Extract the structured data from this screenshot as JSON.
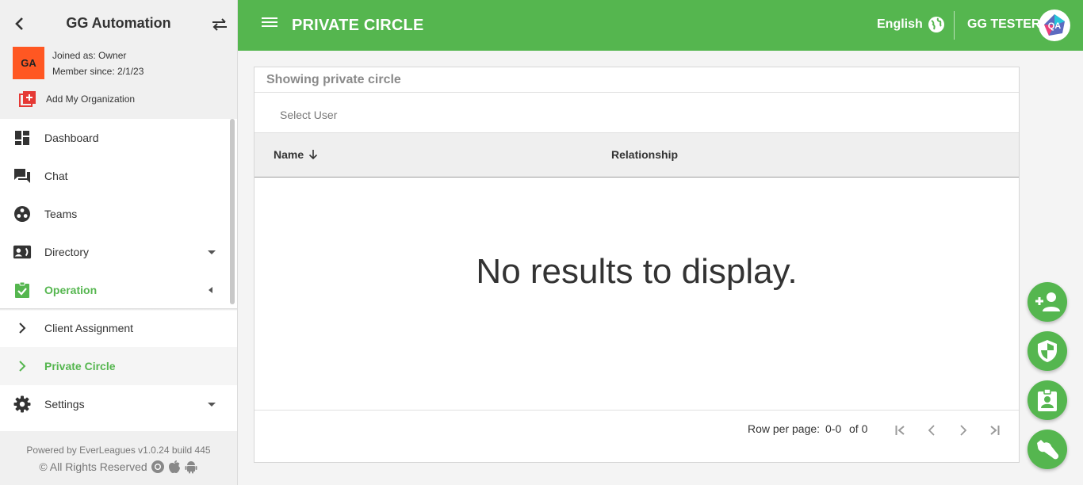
{
  "sidebar": {
    "org_name": "GG Automation",
    "org_avatar_text": "GA",
    "joined_as": "Joined as: Owner",
    "member_since": "Member since: 2/1/23",
    "add_org_label": "Add My Organization",
    "items": [
      {
        "label": "Dashboard",
        "icon": "dashboard-icon"
      },
      {
        "label": "Chat",
        "icon": "chat-icon"
      },
      {
        "label": "Teams",
        "icon": "teams-icon"
      },
      {
        "label": "Directory",
        "icon": "contact-card-icon"
      },
      {
        "label": "Operation",
        "icon": "clipboard-check-icon"
      },
      {
        "label": "Client Assignment",
        "icon": "chevron-right-icon"
      },
      {
        "label": "Private Circle",
        "icon": "chevron-right-icon"
      },
      {
        "label": "Settings",
        "icon": "gear-icon"
      }
    ],
    "footer_powered": "Powered by EverLeagues v1.0.24 build 445",
    "footer_rights": "© All Rights Reserved"
  },
  "topbar": {
    "title": "PRIVATE CIRCLE",
    "language": "English",
    "user_name": "GG TESTER",
    "user_avatar_text": "QA"
  },
  "main": {
    "card_title": "Showing private circle",
    "select_user": "Select User",
    "columns": {
      "name": "Name",
      "relationship": "Relationship"
    },
    "empty_text": "No results to display.",
    "pager": {
      "label": "Row per page:",
      "range": "0-0",
      "of": "of 0"
    }
  },
  "colors": {
    "brand": "#55b64f",
    "avatar": "#ff5722"
  }
}
